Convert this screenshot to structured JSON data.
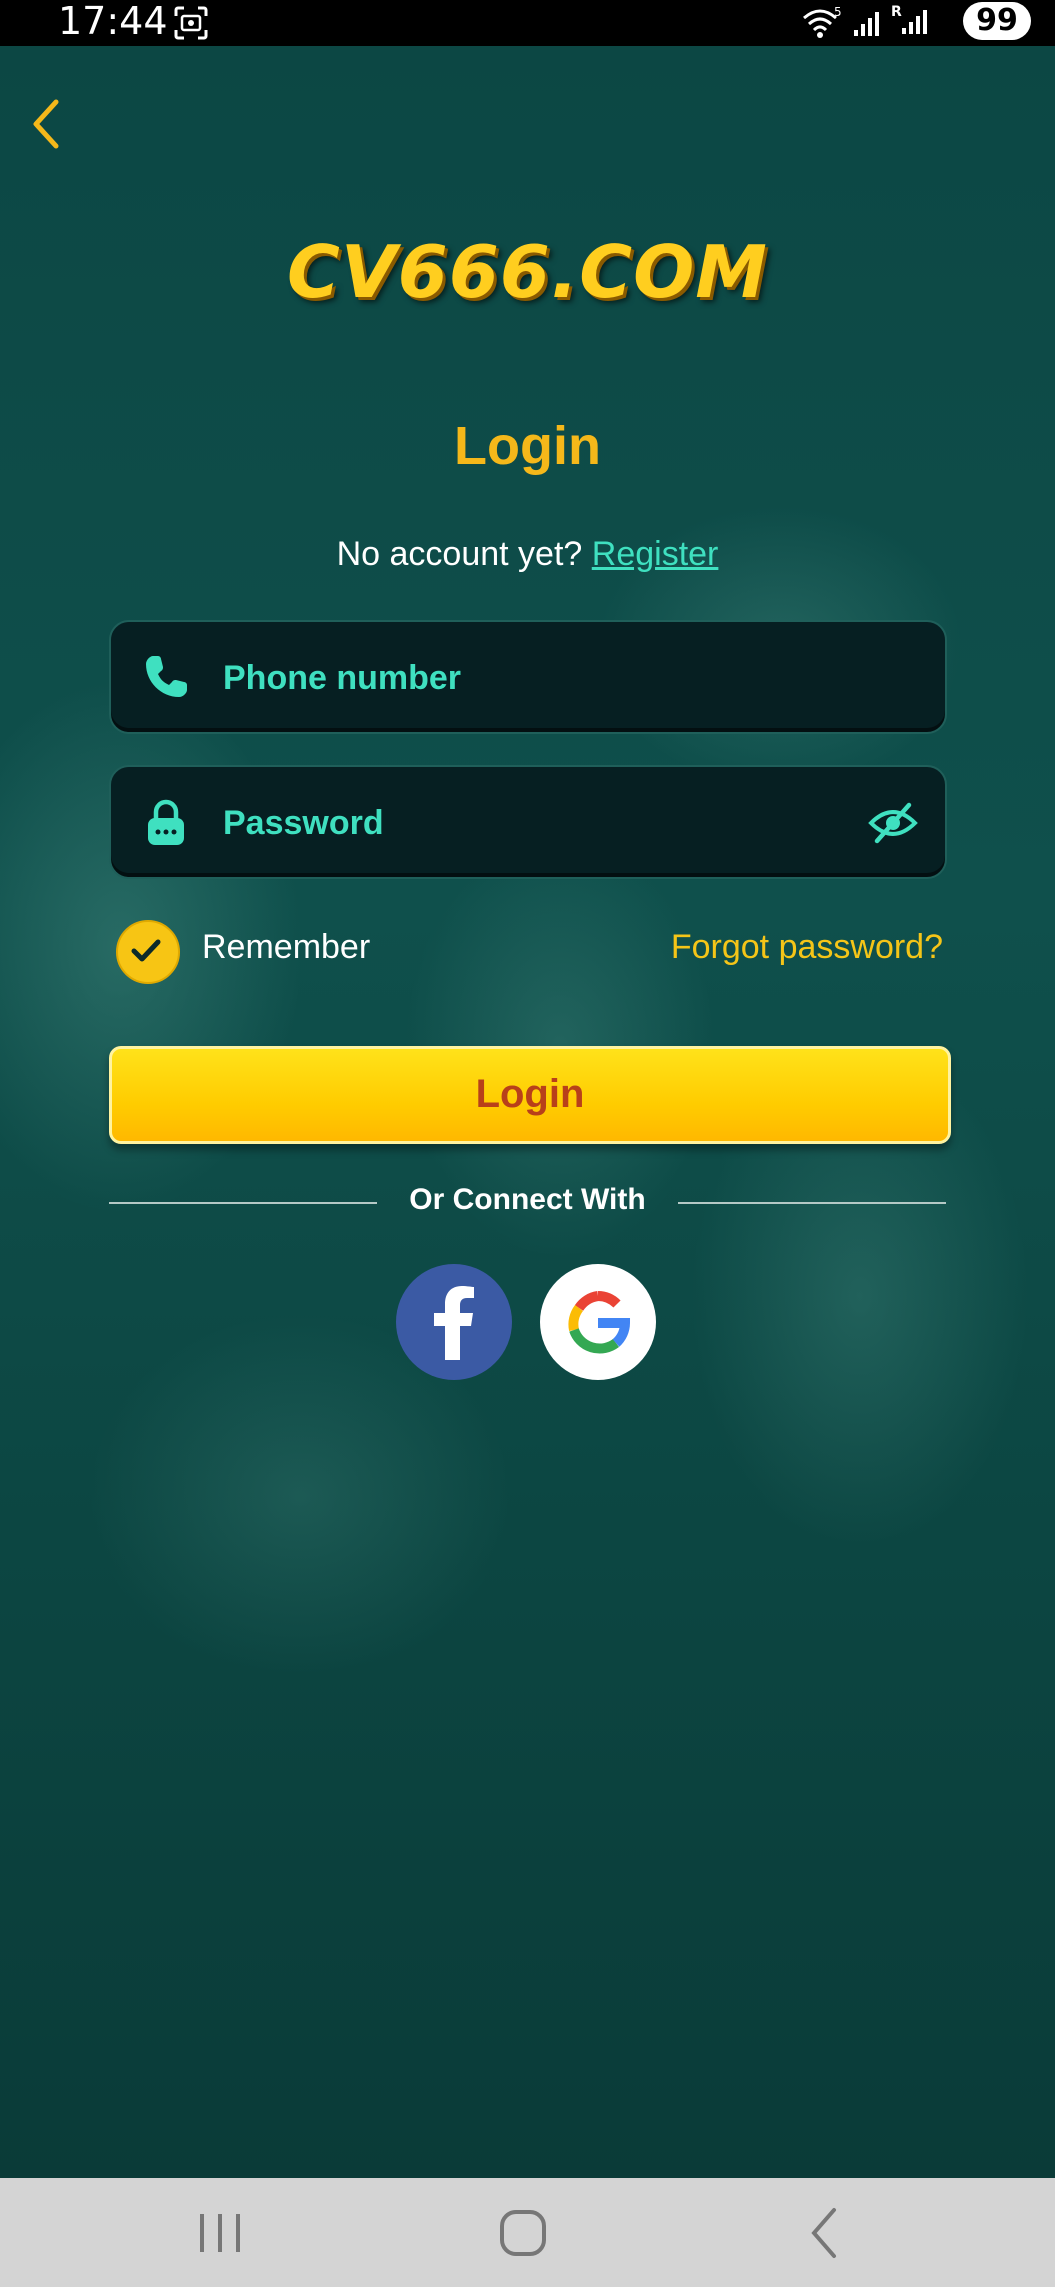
{
  "status_bar": {
    "time": "17:44",
    "wifi_label": "5",
    "signal_label": "R",
    "battery": "99"
  },
  "header": {
    "back_icon": "chevron-left-icon",
    "logo_text": "CV666.COM"
  },
  "login": {
    "title": "Login",
    "no_account_text": "No account yet?",
    "register_link": "Register",
    "phone_placeholder": "Phone number",
    "password_placeholder": "Password",
    "remember_label": "Remember",
    "remember_checked": true,
    "forgot_password": "Forgot password?",
    "login_button": "Login",
    "connect_with": "Or Connect With"
  },
  "social": [
    {
      "name": "Facebook",
      "icon": "facebook-icon"
    },
    {
      "name": "Google",
      "icon": "google-icon"
    }
  ],
  "colors": {
    "accent_yellow": "#f5b81a",
    "accent_teal": "#3fe0c0",
    "background": "#0b3f3c",
    "field_bg": "#061f22"
  }
}
